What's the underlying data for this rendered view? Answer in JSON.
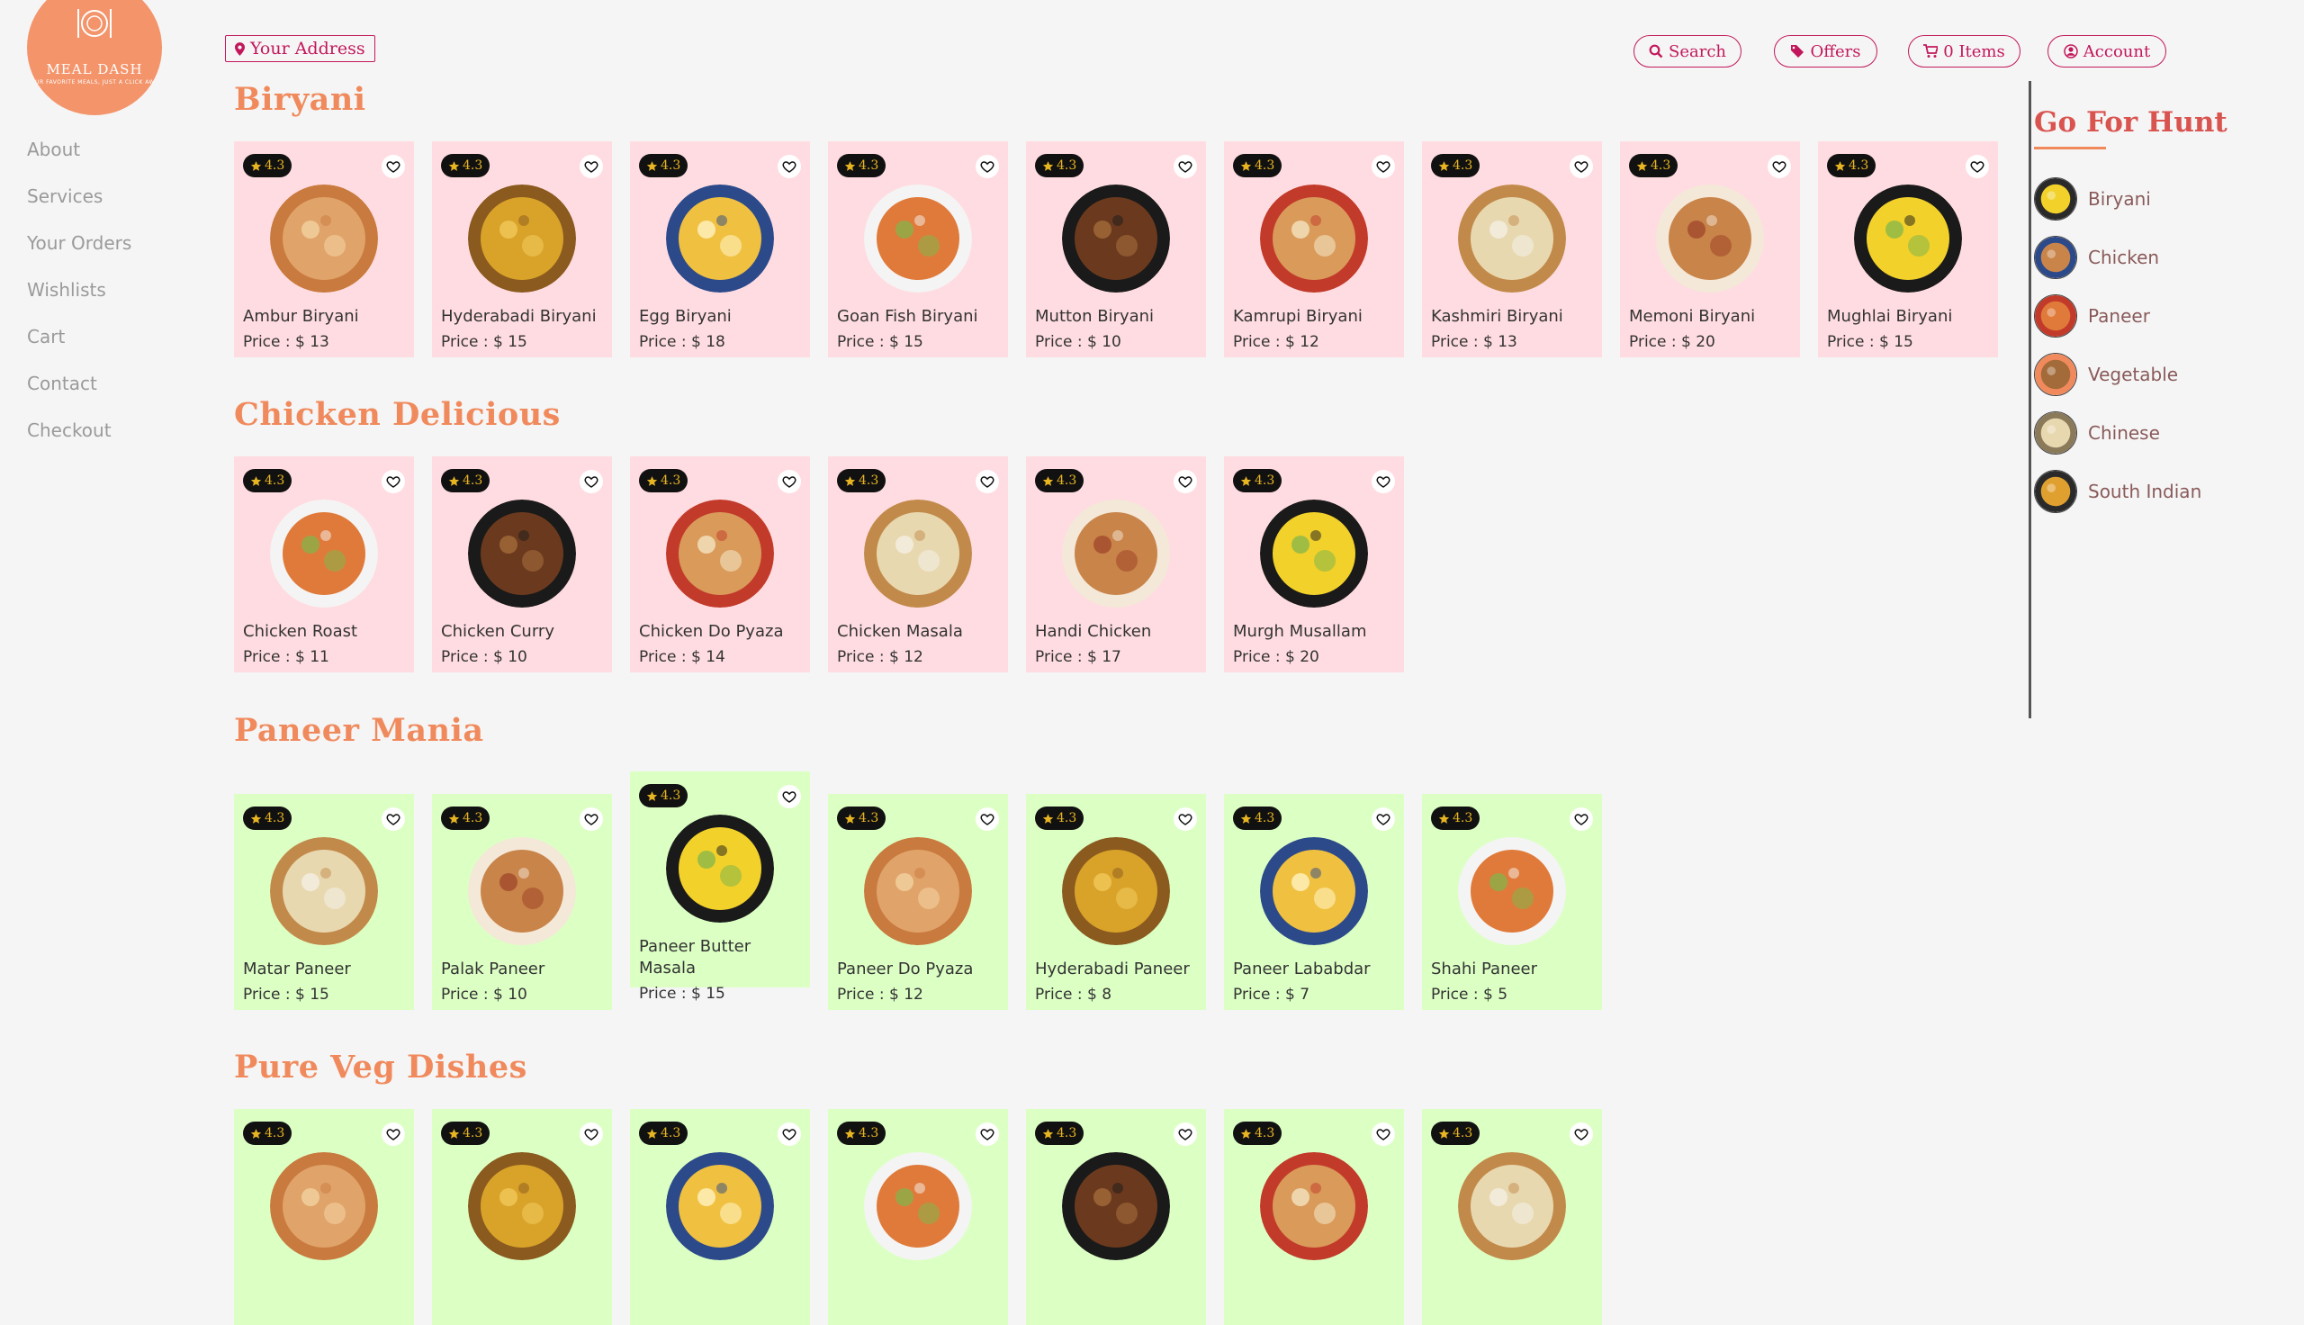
{
  "brand": {
    "name": "MEAL DASH",
    "tagline": "YOUR FAVORITE MEALS, JUST A CLICK AWAY"
  },
  "nav": {
    "links": [
      "About",
      "Services",
      "Your Orders",
      "Wishlists",
      "Cart",
      "Contact",
      "Checkout"
    ]
  },
  "topbar": {
    "address_label": "Your Address",
    "search_label": "Search",
    "offers_label": "Offers",
    "cart_label": "0 Items",
    "account_label": "Account"
  },
  "sections": [
    {
      "title": "Biryani",
      "items": [
        {
          "rating": "4.3",
          "name": "Ambur Biryani",
          "price": "Price : $ 13"
        },
        {
          "rating": "4.3",
          "name": "Hyderabadi Biryani",
          "price": "Price : $ 15"
        },
        {
          "rating": "4.3",
          "name": "Egg Biryani",
          "price": "Price : $ 18"
        },
        {
          "rating": "4.3",
          "name": "Goan Fish Biryani",
          "price": "Price : $ 15"
        },
        {
          "rating": "4.3",
          "name": "Mutton Biryani",
          "price": "Price : $ 10"
        },
        {
          "rating": "4.3",
          "name": "Kamrupi Biryani",
          "price": "Price : $ 12"
        },
        {
          "rating": "4.3",
          "name": "Kashmiri Biryani",
          "price": "Price : $ 13"
        },
        {
          "rating": "4.3",
          "name": "Memoni Biryani",
          "price": "Price : $ 20"
        },
        {
          "rating": "4.3",
          "name": "Mughlai Biryani",
          "price": "Price : $ 15"
        }
      ]
    },
    {
      "title": "Chicken Delicious",
      "items": [
        {
          "rating": "4.3",
          "name": "Chicken Roast",
          "price": "Price : $ 11"
        },
        {
          "rating": "4.3",
          "name": "Chicken Curry",
          "price": "Price : $ 10"
        },
        {
          "rating": "4.3",
          "name": "Chicken Do Pyaza",
          "price": "Price : $ 14"
        },
        {
          "rating": "4.3",
          "name": "Chicken Masala",
          "price": "Price : $ 12"
        },
        {
          "rating": "4.3",
          "name": "Handi Chicken",
          "price": "Price : $ 17"
        },
        {
          "rating": "4.3",
          "name": "Murgh Musallam",
          "price": "Price : $ 20"
        }
      ]
    },
    {
      "title": "Paneer Mania",
      "items": [
        {
          "rating": "4.3",
          "name": "Matar Paneer",
          "price": "Price : $ 15"
        },
        {
          "rating": "4.3",
          "name": "Palak Paneer",
          "price": "Price : $ 10"
        },
        {
          "rating": "4.3",
          "name": "Paneer Butter Masala",
          "price": "Price : $ 15"
        },
        {
          "rating": "4.3",
          "name": "Paneer Do Pyaza",
          "price": "Price : $ 12"
        },
        {
          "rating": "4.3",
          "name": "Hyderabadi Paneer",
          "price": "Price : $ 8"
        },
        {
          "rating": "4.3",
          "name": "Paneer Lababdar",
          "price": "Price : $ 7"
        },
        {
          "rating": "4.3",
          "name": "Shahi Paneer",
          "price": "Price : $ 5"
        }
      ]
    },
    {
      "title": "Pure Veg Dishes",
      "items": [
        {
          "rating": "4.3"
        },
        {
          "rating": "4.3"
        },
        {
          "rating": "4.3"
        },
        {
          "rating": "4.3"
        },
        {
          "rating": "4.3"
        },
        {
          "rating": "4.3"
        },
        {
          "rating": "4.3"
        }
      ]
    }
  ],
  "sidebar": {
    "title": "Go For Hunt",
    "items": [
      "Biryani",
      "Chicken",
      "Paneer",
      "Vegetable",
      "Chinese",
      "South Indian"
    ]
  },
  "colors": {
    "accent": "#f08a5d",
    "button": "#c2185b",
    "card_pink": "#ffdce1",
    "card_green": "#dcffc4"
  }
}
